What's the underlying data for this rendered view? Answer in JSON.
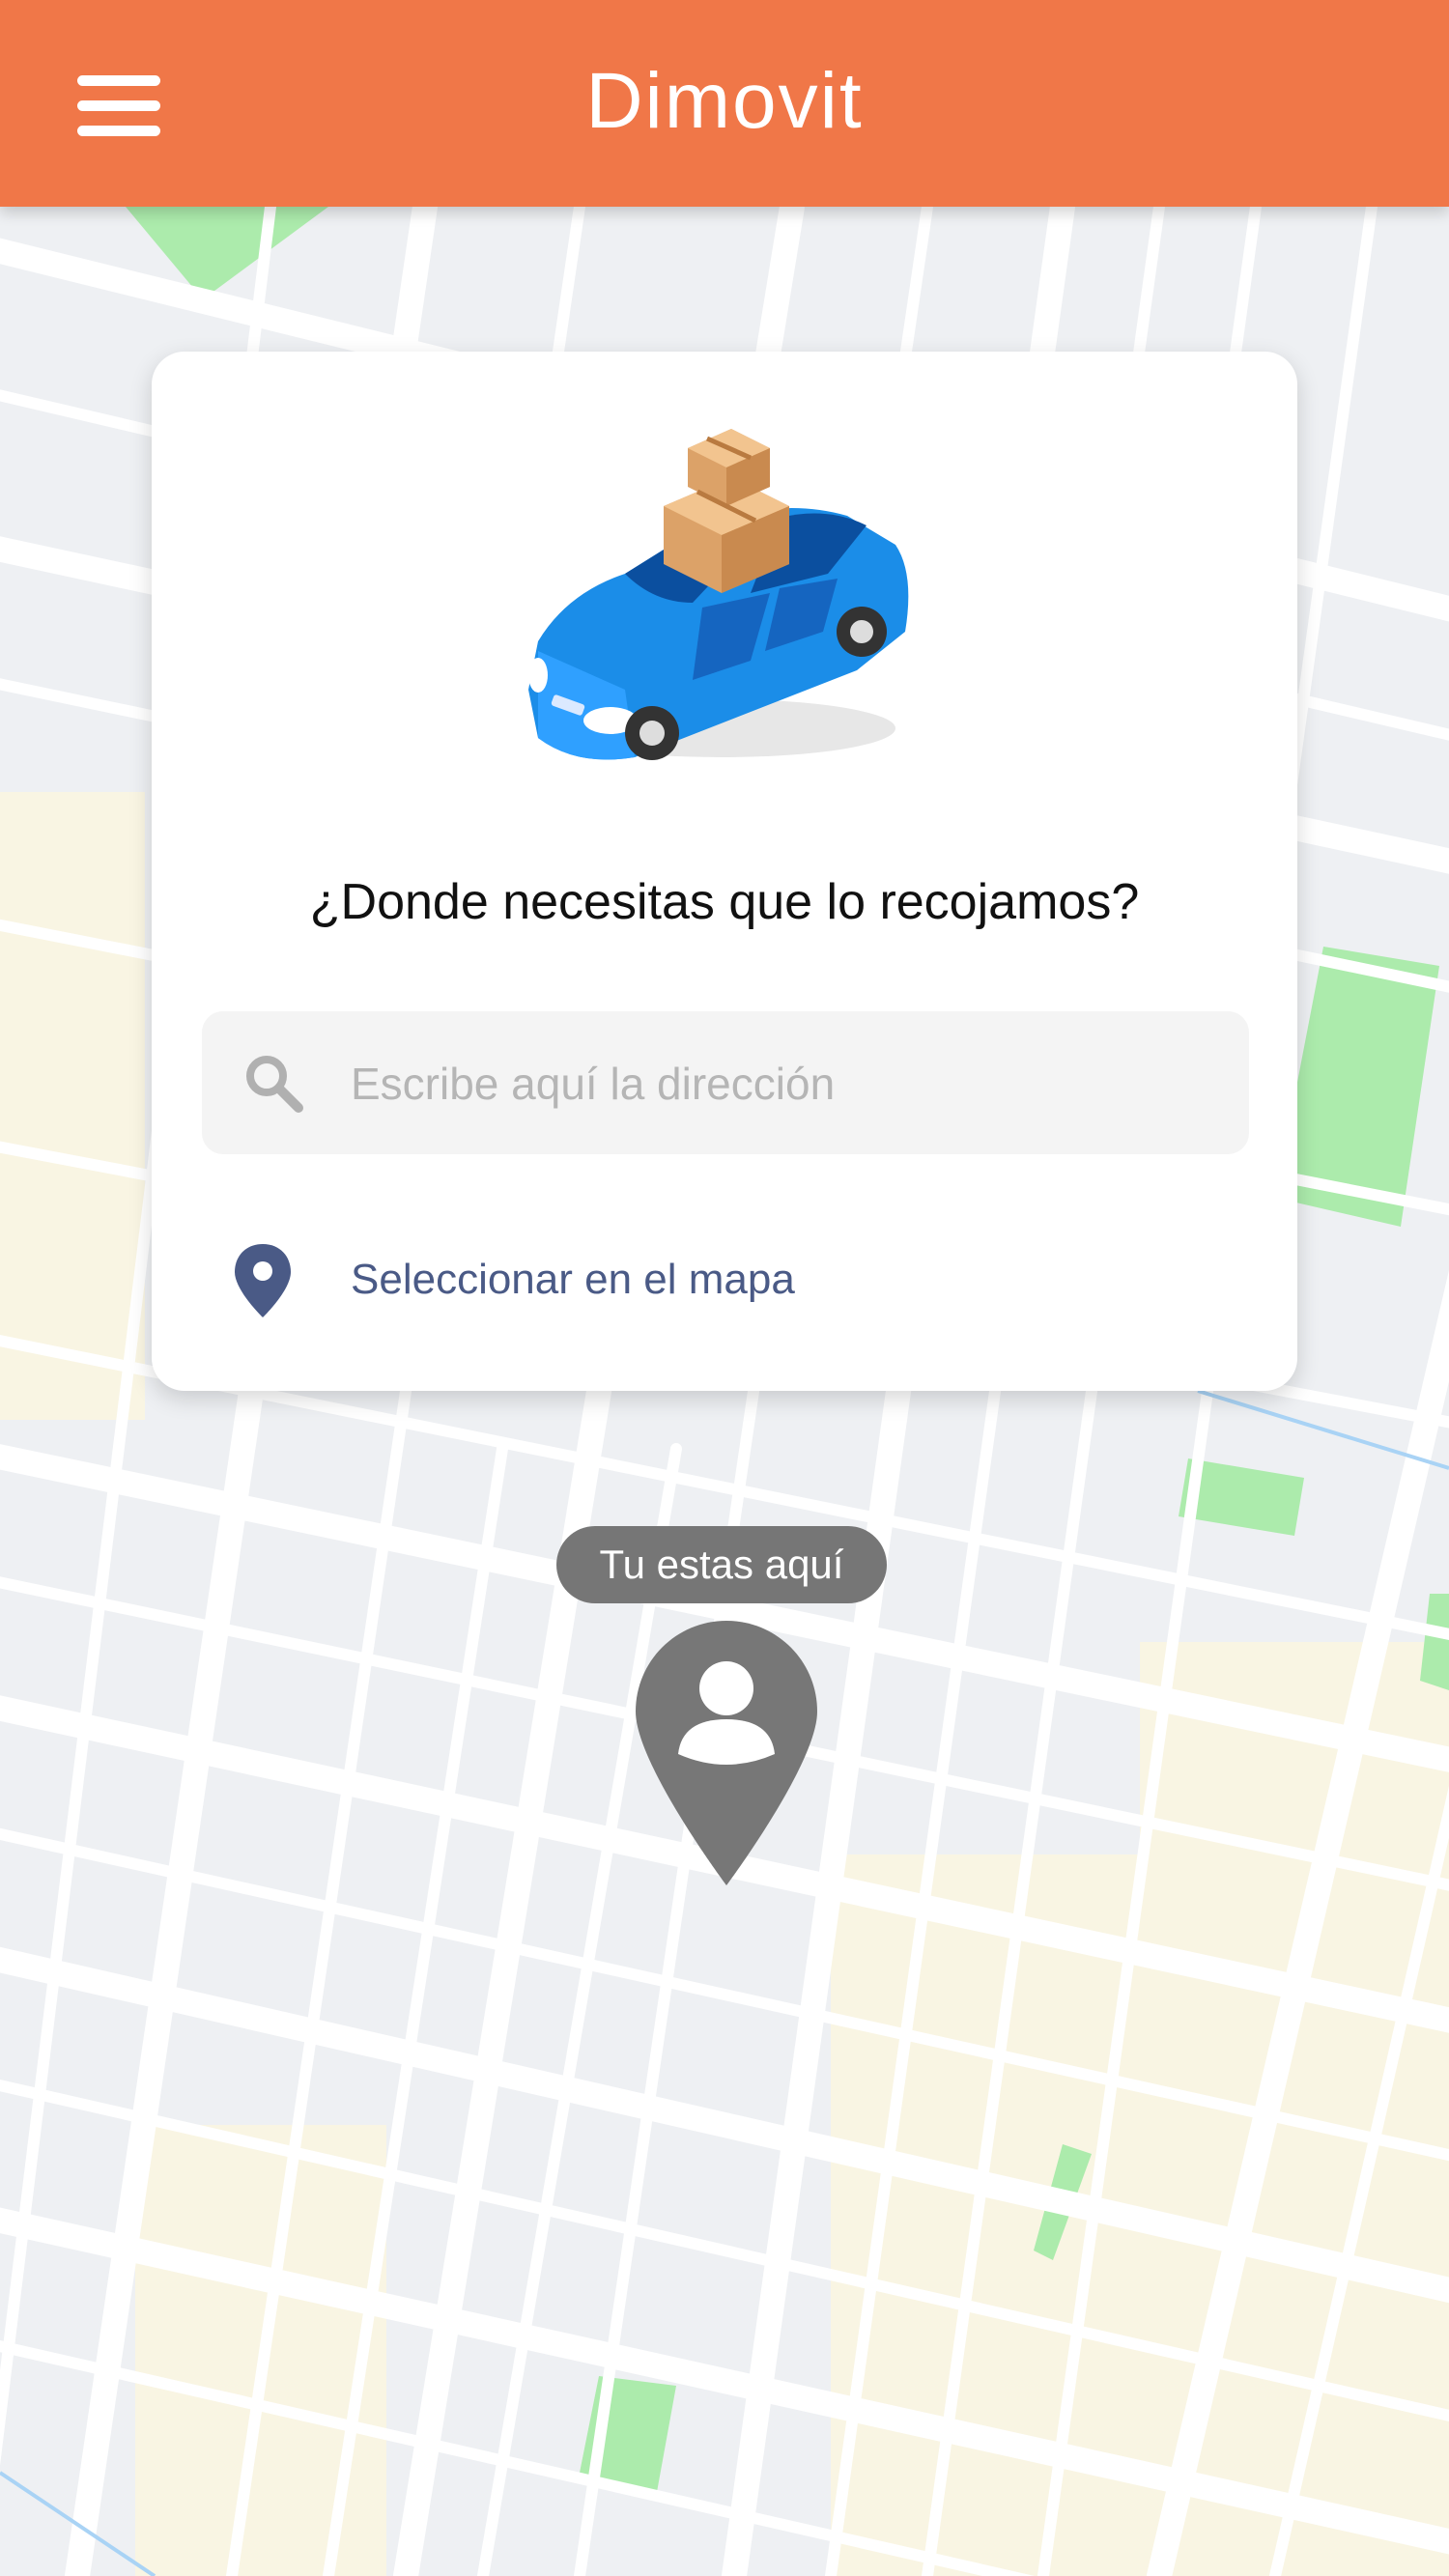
{
  "app_bar": {
    "title": "Dimovit",
    "menu_icon": "hamburger-menu-icon",
    "background": "#f07748"
  },
  "pickup_card": {
    "illustration": "car-with-packages-illustration",
    "question": "¿Donde necesitas que lo recojamos?",
    "search": {
      "icon": "search-icon",
      "placeholder": "Escribe aquí la dirección",
      "value": ""
    },
    "select_on_map": {
      "icon": "location-pin-icon",
      "label": "Seleccionar en el mapa",
      "color": "#4a5a86"
    }
  },
  "map": {
    "current_location_label": "Tu estas aquí",
    "marker_icon": "user-location-pin-icon"
  }
}
